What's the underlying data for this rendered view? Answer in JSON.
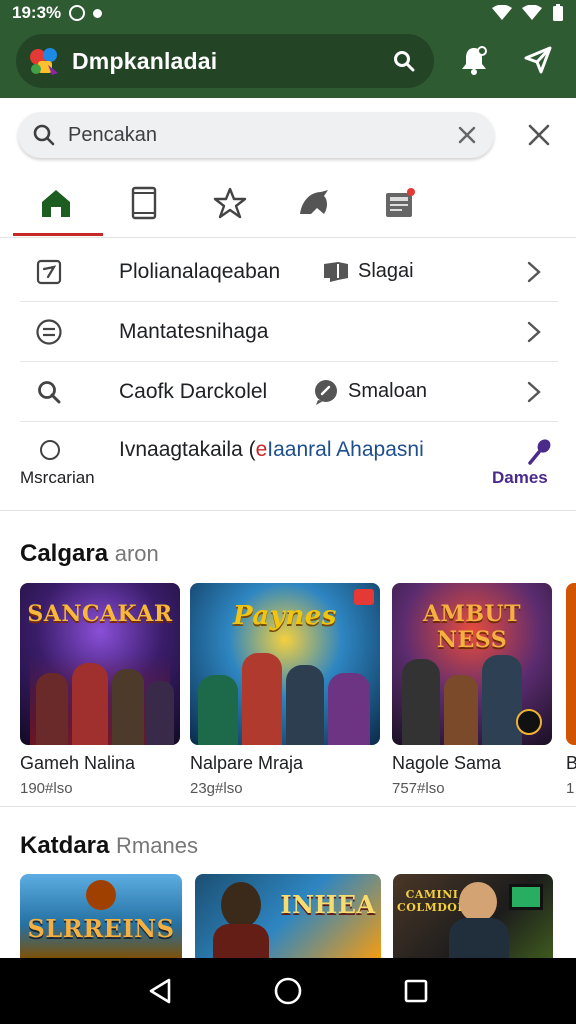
{
  "status_bar": {
    "time": "19:3%"
  },
  "app_bar": {
    "title": "Dmpkanladai",
    "icons": [
      "app-logo",
      "search-icon",
      "bell-icon",
      "send-icon"
    ]
  },
  "search": {
    "placeholder": "Pencakan"
  },
  "tabs": [
    {
      "icon": "home-icon",
      "selected": true
    },
    {
      "icon": "phone-icon",
      "selected": false
    },
    {
      "icon": "star-icon",
      "selected": false
    },
    {
      "icon": "bird-icon",
      "selected": false
    },
    {
      "icon": "news-icon",
      "selected": false
    }
  ],
  "rows": [
    {
      "icon": "edit-box-icon",
      "label": "Plolianalaqeaban",
      "sub_icon": "chat-icon",
      "sub": "Slagai"
    },
    {
      "icon": "menu-circle-icon",
      "label": "Mantatesnihaga"
    },
    {
      "icon": "search-icon",
      "label": "Caofk Darckolel",
      "sub_icon": "chat-bubble-icon",
      "sub": "Smaloan"
    }
  ],
  "row4": {
    "label_main": "Ivnaagtakaila (",
    "label_accent1": "e",
    "label_accent2": "Iaanral Ahapasni",
    "sublabel": "Msrcarian",
    "action": "Dames"
  },
  "section1": {
    "title": "Calgara",
    "subtitle": "aron",
    "cards": [
      {
        "art_title": "SANCAKAR",
        "name": "Gameh Nalina",
        "meta": "190#lso"
      },
      {
        "art_title": "Paynes",
        "name": "Nalpare Mraja",
        "meta": "23g#lso"
      },
      {
        "art_title": "AMBUT NESS",
        "name": "Nagole Sama",
        "meta": "757#lso"
      },
      {
        "name": "B",
        "meta": "1"
      }
    ]
  },
  "section2": {
    "title": "Katdara",
    "subtitle": "Rmanes",
    "cards": [
      {
        "art_title": "SLRREINS"
      },
      {
        "art_title": "INHEA"
      },
      {
        "art_title": "CAMINI COLMDOD"
      }
    ]
  },
  "colors": {
    "primary": "#2f5b33",
    "accent_red": "#c62828",
    "games_purple": "#4a2a8a"
  }
}
